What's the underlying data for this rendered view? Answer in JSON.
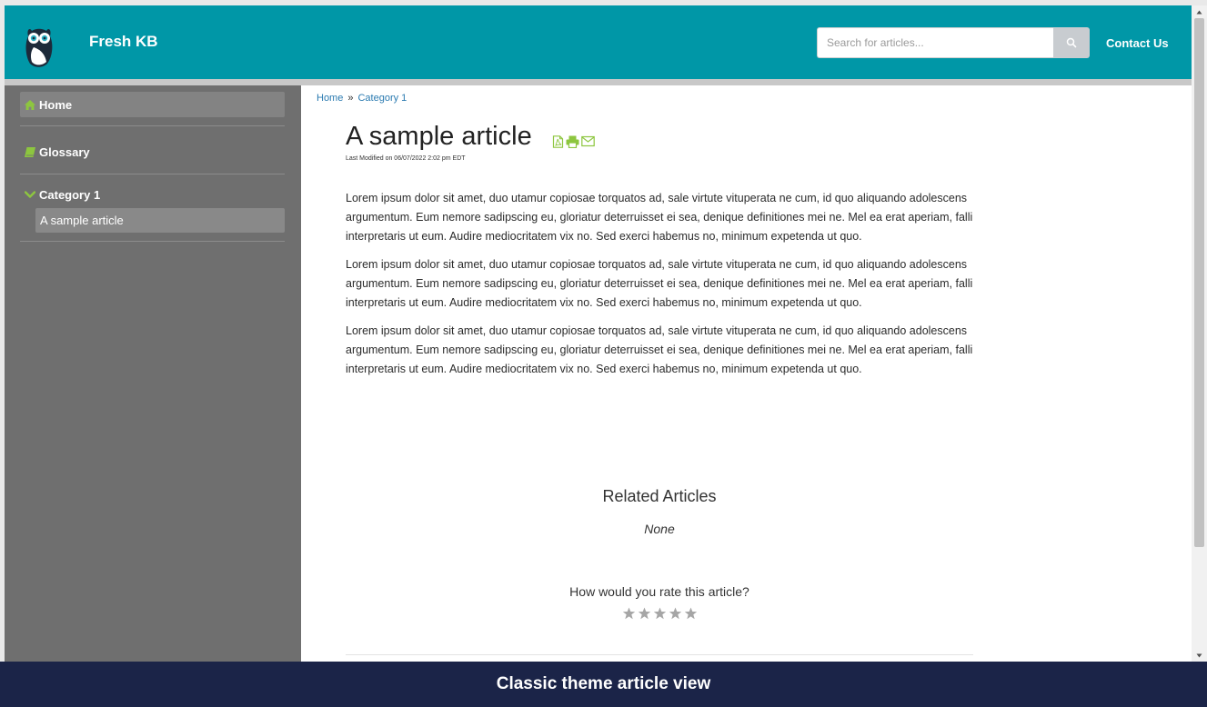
{
  "header": {
    "app_title": "Fresh KB",
    "search": {
      "placeholder": "Search for articles..."
    },
    "contact_label": "Contact Us"
  },
  "sidebar": {
    "items": [
      {
        "label": "Home",
        "icon": "home-icon"
      },
      {
        "label": "Glossary",
        "icon": "book-icon"
      },
      {
        "label": "Category 1",
        "icon": "chevron-down-icon",
        "expanded": true,
        "children": [
          {
            "label": "A sample article",
            "active": true
          }
        ]
      }
    ]
  },
  "breadcrumb": {
    "items": [
      "Home",
      "Category 1"
    ],
    "separator": "»"
  },
  "article": {
    "title": "A sample article",
    "modified": "Last Modified on 06/07/2022 2:02 pm EDT",
    "paragraphs": [
      "Lorem ipsum dolor sit amet, duo utamur copiosae torquatos ad, sale virtute vituperata ne cum, id quo aliquando adolescens argumentum. Eum nemore sadipscing eu, gloriatur deterruisset ei sea, denique definitiones mei ne. Mel ea erat aperiam, falli interpretaris ut eum. Audire mediocritatem vix no. Sed exerci habemus no, minimum expetenda ut quo.",
      "Lorem ipsum dolor sit amet, duo utamur copiosae torquatos ad, sale virtute vituperata ne cum, id quo aliquando adolescens argumentum. Eum nemore sadipscing eu, gloriatur deterruisset ei sea, denique definitiones mei ne. Mel ea erat aperiam, falli interpretaris ut eum. Audire mediocritatem vix no. Sed exerci habemus no, minimum expetenda ut quo.",
      "Lorem ipsum dolor sit amet, duo utamur copiosae torquatos ad, sale virtute vituperata ne cum, id quo aliquando adolescens argumentum. Eum nemore sadipscing eu, gloriatur deterruisset ei sea, denique definitiones mei ne. Mel ea erat aperiam, falli interpretaris ut eum. Audire mediocritatem vix no. Sed exerci habemus no, minimum expetenda ut quo."
    ],
    "tools": [
      "pdf-icon",
      "print-icon",
      "email-icon"
    ]
  },
  "related": {
    "title": "Related Articles",
    "empty_text": "None"
  },
  "rating": {
    "question": "How would you rate this article?",
    "max_stars": 5,
    "value": 0
  },
  "caption": "Classic theme article view",
  "colors": {
    "header_bg": "#0097a7",
    "sidebar_bg": "#6f6f6f",
    "accent_green": "#8dc63f",
    "link_blue": "#2a7ab0",
    "caption_bg": "#1b2448"
  }
}
